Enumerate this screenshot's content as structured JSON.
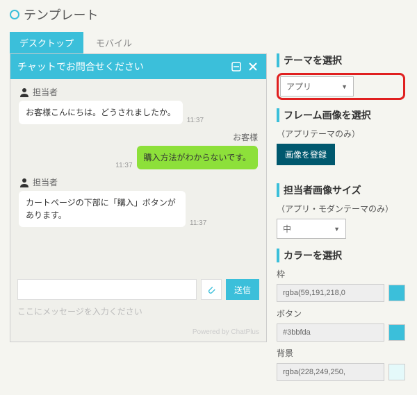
{
  "page": {
    "title": "テンプレート"
  },
  "tabs": {
    "desktop": "デスクトップ",
    "mobile": "モバイル"
  },
  "chat": {
    "header": "チャットでお問合せください",
    "agent_label": "担当者",
    "customer_label": "お客様",
    "msg1": "お客様こんにちは。どうされましたか。",
    "time1": "11:37",
    "msg2": "購入方法がわからないです。",
    "time2": "11:37",
    "msg3": "カートページの下部に「購入」ボタンがあります。",
    "time3": "11:37",
    "send": "送信",
    "placeholder": "ここにメッセージを入力ください",
    "powered": "Powered by ChatPlus"
  },
  "sidebar": {
    "theme_head": "テーマを選択",
    "theme_value": "アプリ",
    "frame_head": "フレーム画像を選択",
    "frame_sub": "（アプリテーマのみ）",
    "frame_btn": "画像を登録",
    "size_head": "担当者画像サイズ",
    "size_sub": "（アプリ・モダンテーマのみ）",
    "size_value": "中",
    "color_head": "カラーを選択",
    "frame_color_label": "枠",
    "frame_color_value": "rgba(59,191,218,0",
    "btn_color_label": "ボタン",
    "btn_color_value": "#3bbfda",
    "bg_color_label": "背景",
    "bg_color_value": "rgba(228,249,250,"
  },
  "colors": {
    "frame": "#3bbfda",
    "button": "#3bbfda",
    "bg": "#e4f9fa"
  }
}
